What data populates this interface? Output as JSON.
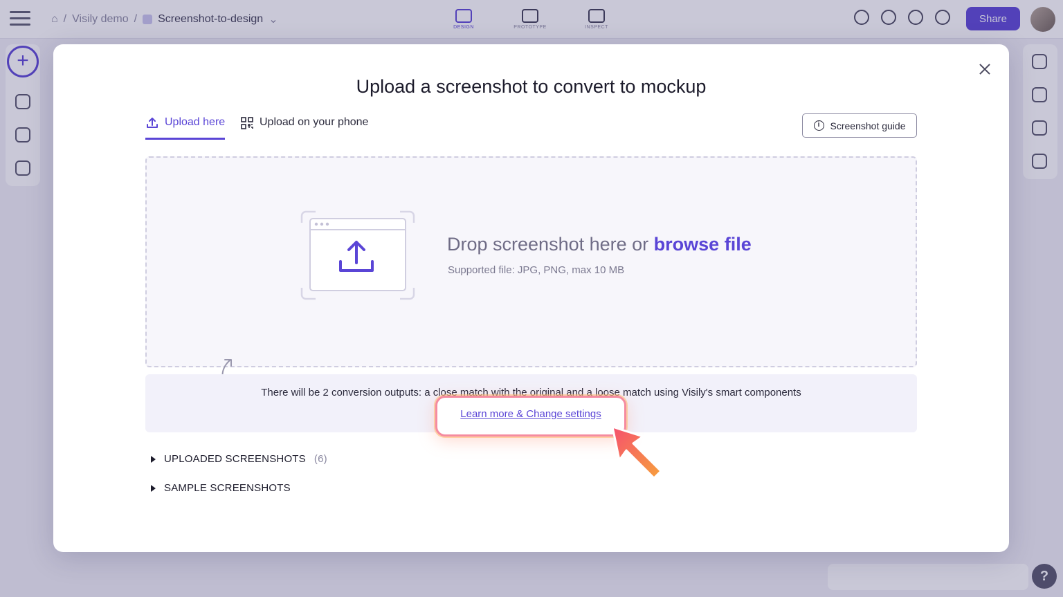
{
  "app": {
    "breadcrumb": {
      "sep": "/",
      "project": "Visily demo",
      "board": "Screenshot-to-design"
    },
    "modes": [
      "DESIGN",
      "PROTOTYPE",
      "INSPECT"
    ],
    "share_label": "Share",
    "help_label": "?"
  },
  "modal": {
    "title": "Upload a screenshot to convert to mockup",
    "tabs": [
      {
        "label": "Upload here",
        "icon": "upload-icon",
        "active": true
      },
      {
        "label": "Upload on your phone",
        "icon": "qr-code-icon",
        "active": false
      }
    ],
    "guide_button": "Screenshot guide",
    "dropzone": {
      "text_prefix": "Drop screenshot here or",
      "browse_label": "browse file",
      "supported": "Supported file: JPG, PNG, max 10 MB"
    },
    "info": {
      "text": "There will be 2 conversion outputs: a close match with the original and a loose match using Visily's smart components",
      "link": "Learn more & Change settings"
    },
    "sections": [
      {
        "label": "UPLOADED SCREENSHOTS",
        "count": "(6)"
      },
      {
        "label": "SAMPLE SCREENSHOTS",
        "count": ""
      }
    ]
  },
  "colors": {
    "accent": "#5a45d6",
    "highlight": "#f58ba0"
  }
}
